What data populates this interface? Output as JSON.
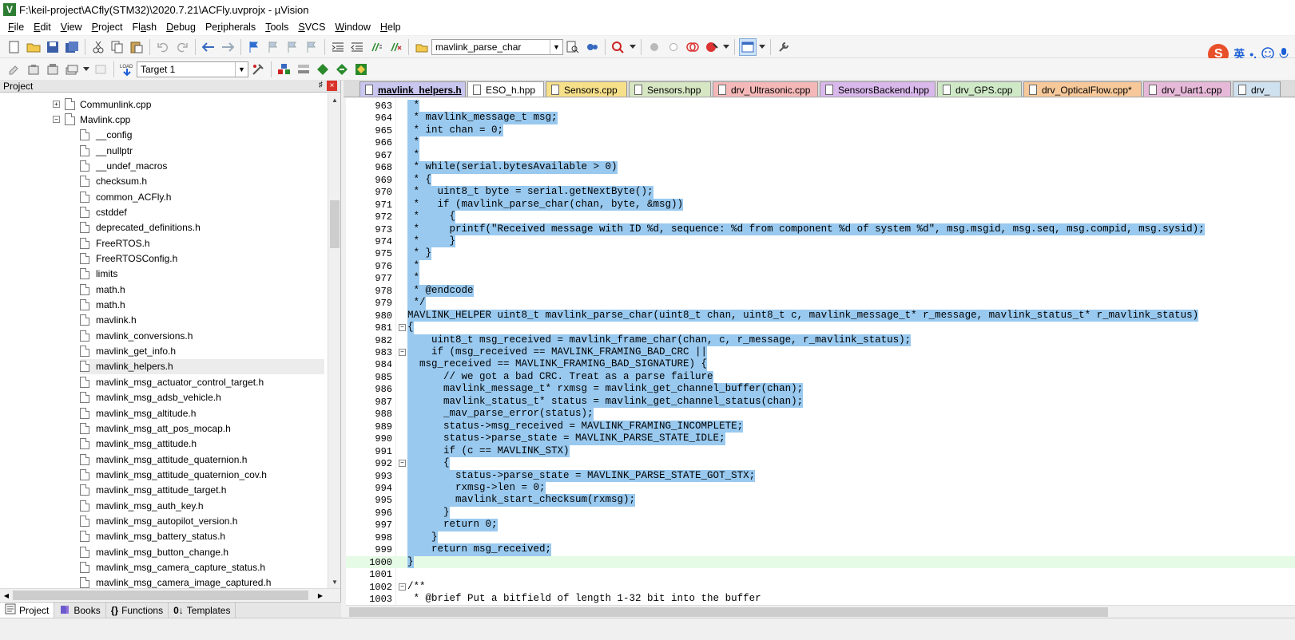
{
  "window": {
    "title": "F:\\keil-project\\ACfly(STM32)\\2020.7.21\\ACFly.uvprojx - µVision",
    "logo": "V"
  },
  "menu": [
    {
      "pre": "",
      "u": "F",
      "post": "ile"
    },
    {
      "pre": "",
      "u": "E",
      "post": "dit"
    },
    {
      "pre": "",
      "u": "V",
      "post": "iew"
    },
    {
      "pre": "",
      "u": "P",
      "post": "roject"
    },
    {
      "pre": "Fl",
      "u": "a",
      "post": "sh"
    },
    {
      "pre": "",
      "u": "D",
      "post": "ebug"
    },
    {
      "pre": "Pe",
      "u": "r",
      "post": "ipherals"
    },
    {
      "pre": "",
      "u": "T",
      "post": "ools"
    },
    {
      "pre": "",
      "u": "S",
      "post": "VCS"
    },
    {
      "pre": "",
      "u": "W",
      "post": "indow"
    },
    {
      "pre": "",
      "u": "H",
      "post": "elp"
    }
  ],
  "toolbar": {
    "find_combo": "mavlink_parse_char",
    "target_combo": "Target 1",
    "load_label": "LOAD"
  },
  "ime": {
    "logo": "S",
    "lang": "英",
    "punct": "•,"
  },
  "project_panel": {
    "title": "Project",
    "pin": "♯",
    "close": "×",
    "scroll_up": "▲",
    "scroll_down": "▼",
    "scroll_left": "◀",
    "scroll_right": "▶",
    "tree": [
      {
        "label": "Communlink.cpp",
        "expander": "+",
        "level": 0
      },
      {
        "label": "Mavlink.cpp",
        "expander": "−",
        "level": 0
      },
      {
        "label": "__config",
        "level": 1
      },
      {
        "label": "__nullptr",
        "level": 1
      },
      {
        "label": "__undef_macros",
        "level": 1
      },
      {
        "label": "checksum.h",
        "level": 1
      },
      {
        "label": "common_ACFly.h",
        "level": 1
      },
      {
        "label": "cstddef",
        "level": 1
      },
      {
        "label": "deprecated_definitions.h",
        "level": 1
      },
      {
        "label": "FreeRTOS.h",
        "level": 1
      },
      {
        "label": "FreeRTOSConfig.h",
        "level": 1
      },
      {
        "label": "limits",
        "level": 1
      },
      {
        "label": "math.h",
        "level": 1
      },
      {
        "label": "math.h",
        "level": 1
      },
      {
        "label": "mavlink.h",
        "level": 1
      },
      {
        "label": "mavlink_conversions.h",
        "level": 1
      },
      {
        "label": "mavlink_get_info.h",
        "level": 1
      },
      {
        "label": "mavlink_helpers.h",
        "level": 1,
        "selected": true
      },
      {
        "label": "mavlink_msg_actuator_control_target.h",
        "level": 1
      },
      {
        "label": "mavlink_msg_adsb_vehicle.h",
        "level": 1
      },
      {
        "label": "mavlink_msg_altitude.h",
        "level": 1
      },
      {
        "label": "mavlink_msg_att_pos_mocap.h",
        "level": 1
      },
      {
        "label": "mavlink_msg_attitude.h",
        "level": 1
      },
      {
        "label": "mavlink_msg_attitude_quaternion.h",
        "level": 1
      },
      {
        "label": "mavlink_msg_attitude_quaternion_cov.h",
        "level": 1
      },
      {
        "label": "mavlink_msg_attitude_target.h",
        "level": 1
      },
      {
        "label": "mavlink_msg_auth_key.h",
        "level": 1
      },
      {
        "label": "mavlink_msg_autopilot_version.h",
        "level": 1
      },
      {
        "label": "mavlink_msg_battery_status.h",
        "level": 1
      },
      {
        "label": "mavlink_msg_button_change.h",
        "level": 1
      },
      {
        "label": "mavlink_msg_camera_capture_status.h",
        "level": 1
      },
      {
        "label": "mavlink_msg_camera_image_captured.h",
        "level": 1
      }
    ],
    "bottom_tabs": [
      {
        "label": "Project",
        "active": true,
        "icon": "project-icon"
      },
      {
        "label": "Books",
        "icon": "books-icon"
      },
      {
        "label": "Functions",
        "glyph": "{}",
        "icon": "functions-icon"
      },
      {
        "label": "Templates",
        "glyph": "0↓",
        "icon": "templates-icon"
      }
    ]
  },
  "editor_tabs": [
    {
      "label": "mavlink_helpers.h",
      "color": "#c9c6ef",
      "active": true
    },
    {
      "label": "ESO_h.hpp",
      "color": "#ffffff"
    },
    {
      "label": "Sensors.cpp",
      "color": "#f7e08a"
    },
    {
      "label": "Sensors.hpp",
      "color": "#d7e6c3"
    },
    {
      "label": "drv_Ultrasonic.cpp",
      "color": "#f5b8b8"
    },
    {
      "label": "SensorsBackend.hpp",
      "color": "#d9b8ec"
    },
    {
      "label": "drv_GPS.cpp",
      "color": "#cfe9c7"
    },
    {
      "label": "drv_OpticalFlow.cpp*",
      "color": "#f7c89a"
    },
    {
      "label": "drv_Uart1.cpp",
      "color": "#e7b9d9"
    },
    {
      "label": "drv_",
      "color": "#cfe0ee"
    }
  ],
  "code": [
    {
      "n": "963",
      "t": " *",
      "hl": true
    },
    {
      "n": "964",
      "t": " * mavlink_message_t msg;",
      "hl": true
    },
    {
      "n": "965",
      "t": " * int chan = 0;",
      "hl": true
    },
    {
      "n": "966",
      "t": " *",
      "hl": true
    },
    {
      "n": "967",
      "t": " *",
      "hl": true
    },
    {
      "n": "968",
      "t": " * while(serial.bytesAvailable > 0)",
      "hl": true
    },
    {
      "n": "969",
      "t": " * {",
      "hl": true
    },
    {
      "n": "970",
      "t": " *   uint8_t byte = serial.getNextByte();",
      "hl": true
    },
    {
      "n": "971",
      "t": " *   if (mavlink_parse_char(chan, byte, &msg))",
      "hl": true
    },
    {
      "n": "972",
      "t": " *     {",
      "hl": true
    },
    {
      "n": "973",
      "t": " *     printf(\"Received message with ID %d, sequence: %d from component %d of system %d\", msg.msgid, msg.seq, msg.compid, msg.sysid);",
      "hl": true
    },
    {
      "n": "974",
      "t": " *     }",
      "hl": true
    },
    {
      "n": "975",
      "t": " * }",
      "hl": true
    },
    {
      "n": "976",
      "t": " *",
      "hl": true
    },
    {
      "n": "977",
      "t": " *",
      "hl": true
    },
    {
      "n": "978",
      "t": " * @endcode",
      "hl": true
    },
    {
      "n": "979",
      "t": " */",
      "hl": true
    },
    {
      "n": "980",
      "t": "MAVLINK_HELPER uint8_t mavlink_parse_char(uint8_t chan, uint8_t c, mavlink_message_t* r_message, mavlink_status_t* r_mavlink_status)",
      "hl": true
    },
    {
      "n": "981",
      "t": "{",
      "hl": true,
      "fold": "−"
    },
    {
      "n": "982",
      "t": "    uint8_t msg_received = mavlink_frame_char(chan, c, r_message, r_mavlink_status);",
      "hl": true
    },
    {
      "n": "983",
      "t": "    if (msg_received == MAVLINK_FRAMING_BAD_CRC ||",
      "hl": true,
      "fold": "−"
    },
    {
      "n": "984",
      "t": "  msg_received == MAVLINK_FRAMING_BAD_SIGNATURE) {",
      "hl": true
    },
    {
      "n": "985",
      "t": "      // we got a bad CRC. Treat as a parse failure",
      "hl": true
    },
    {
      "n": "986",
      "t": "      mavlink_message_t* rxmsg = mavlink_get_channel_buffer(chan);",
      "hl": true
    },
    {
      "n": "987",
      "t": "      mavlink_status_t* status = mavlink_get_channel_status(chan);",
      "hl": true
    },
    {
      "n": "988",
      "t": "      _mav_parse_error(status);",
      "hl": true
    },
    {
      "n": "989",
      "t": "      status->msg_received = MAVLINK_FRAMING_INCOMPLETE;",
      "hl": true
    },
    {
      "n": "990",
      "t": "      status->parse_state = MAVLINK_PARSE_STATE_IDLE;",
      "hl": true
    },
    {
      "n": "991",
      "t": "      if (c == MAVLINK_STX)",
      "hl": true
    },
    {
      "n": "992",
      "t": "      {",
      "hl": true,
      "fold": "−"
    },
    {
      "n": "993",
      "t": "        status->parse_state = MAVLINK_PARSE_STATE_GOT_STX;",
      "hl": true
    },
    {
      "n": "994",
      "t": "        rxmsg->len = 0;",
      "hl": true
    },
    {
      "n": "995",
      "t": "        mavlink_start_checksum(rxmsg);",
      "hl": true
    },
    {
      "n": "996",
      "t": "      }",
      "hl": true
    },
    {
      "n": "997",
      "t": "      return 0;",
      "hl": true
    },
    {
      "n": "998",
      "t": "    }",
      "hl": true
    },
    {
      "n": "999",
      "t": "    return msg_received;",
      "hl": true
    },
    {
      "n": "1000",
      "t": "}",
      "hl": true,
      "current": true
    },
    {
      "n": "1001",
      "t": ""
    },
    {
      "n": "1002",
      "t": "/**",
      "fold": "−"
    },
    {
      "n": "1003",
      "t": " * @brief Put a bitfield of length 1-32 bit into the buffer"
    }
  ]
}
